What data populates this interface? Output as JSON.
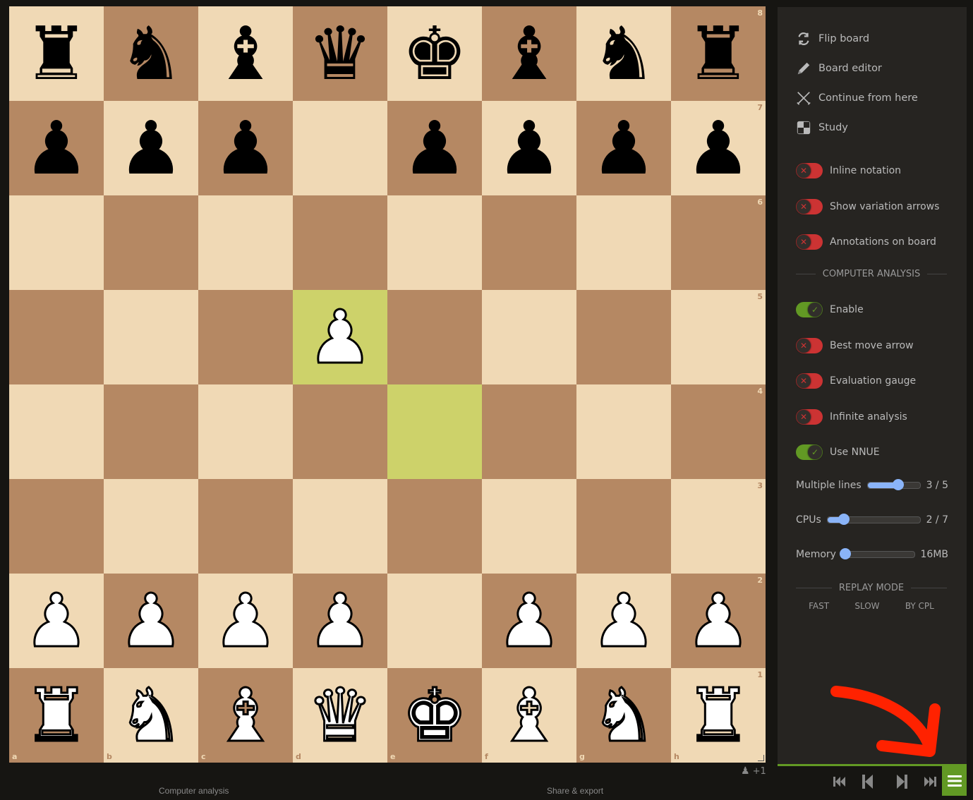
{
  "board": {
    "ranks": [
      "8",
      "7",
      "6",
      "5",
      "4",
      "3",
      "2",
      "1"
    ],
    "files": [
      "a",
      "b",
      "c",
      "d",
      "e",
      "f",
      "g",
      "h"
    ],
    "position": [
      [
        "br",
        "bn",
        "bb",
        "bq",
        "bk",
        "bb",
        "bn",
        "br"
      ],
      [
        "bp",
        "bp",
        "bp",
        "",
        "bp",
        "bp",
        "bp",
        "bp"
      ],
      [
        "",
        "",
        "",
        "",
        "",
        "",
        "",
        ""
      ],
      [
        "",
        "",
        "",
        "wp",
        "",
        "",
        "",
        ""
      ],
      [
        "",
        "",
        "",
        "",
        "",
        "",
        "",
        ""
      ],
      [
        "",
        "",
        "",
        "",
        "",
        "",
        "",
        ""
      ],
      [
        "wp",
        "wp",
        "wp",
        "wp",
        "",
        "wp",
        "wp",
        "wp"
      ],
      [
        "wr",
        "wn",
        "wb",
        "wq",
        "wk",
        "wb",
        "wn",
        "wr"
      ]
    ],
    "highlighted_squares": [
      "d5",
      "e4"
    ],
    "colors": {
      "light": "#f0d9b5",
      "dark": "#b58863",
      "highlight": "#cdd26a"
    }
  },
  "panel": {
    "actions": [
      {
        "label": "Flip board",
        "icon": "flip-icon"
      },
      {
        "label": "Board editor",
        "icon": "pencil-icon"
      },
      {
        "label": "Continue from here",
        "icon": "swords-icon"
      },
      {
        "label": "Study",
        "icon": "study-icon"
      }
    ],
    "toggles": [
      {
        "label": "Inline notation",
        "on": false
      },
      {
        "label": "Show variation arrows",
        "on": false
      },
      {
        "label": "Annotations on board",
        "on": false
      }
    ],
    "computer_analysis_title": "COMPUTER ANALYSIS",
    "analysis_toggles": [
      {
        "label": "Enable",
        "on": true
      },
      {
        "label": "Best move arrow",
        "on": false
      },
      {
        "label": "Evaluation gauge",
        "on": false
      },
      {
        "label": "Infinite analysis",
        "on": false
      },
      {
        "label": "Use NNUE",
        "on": true
      }
    ],
    "sliders": [
      {
        "label": "Multiple lines",
        "value_text": "3 / 5",
        "fraction": 0.58
      },
      {
        "label": "CPUs",
        "value_text": "2 / 7",
        "fraction": 0.18
      },
      {
        "label": "Memory",
        "value_text": "16MB",
        "fraction": 0.0
      }
    ],
    "replay_mode_title": "REPLAY MODE",
    "replay_modes": [
      "FAST",
      "SLOW",
      "BY CPL"
    ],
    "accent": "#629924",
    "toggle_off_color": "#cc3333"
  },
  "players": {
    "count_text": "+1"
  },
  "bottom_tabs": [
    "Computer analysis",
    "Share & export"
  ],
  "annotation_arrow_color": "#ff2200"
}
